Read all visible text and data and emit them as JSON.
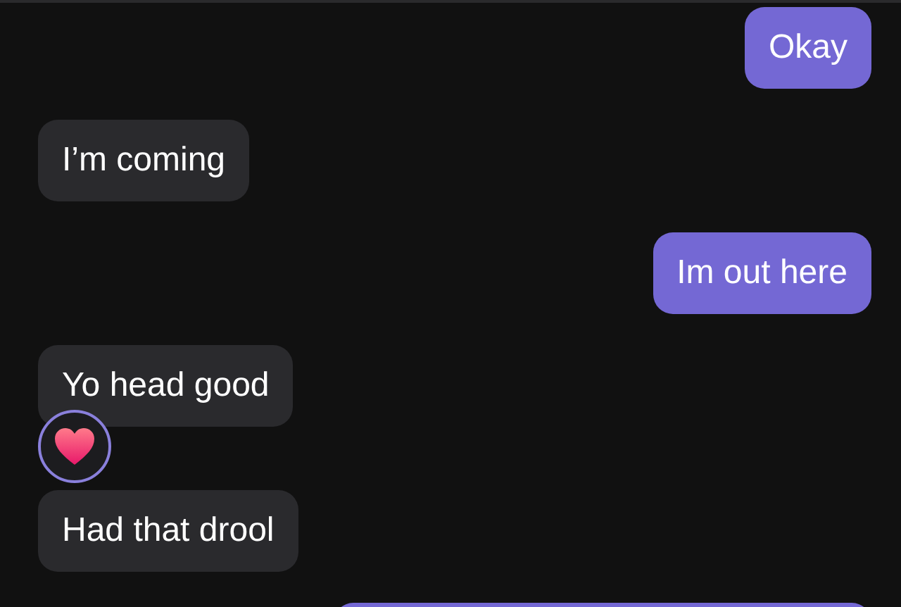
{
  "messages": [
    {
      "kind": "sent",
      "text": "Okay"
    },
    {
      "kind": "received",
      "text": "I’m coming"
    },
    {
      "kind": "sent",
      "text": "Im out here"
    },
    {
      "kind": "received",
      "text": "Yo head good",
      "reacted": true
    },
    {
      "kind": "received",
      "text": "Had that drool"
    },
    {
      "kind": "sent"
    }
  ]
}
